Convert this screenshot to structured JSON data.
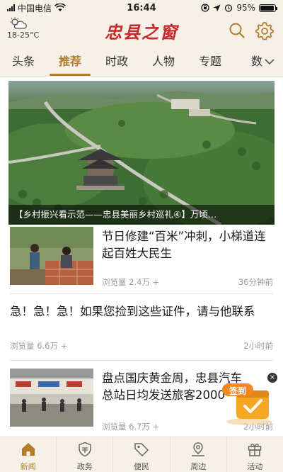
{
  "status_bar": {
    "carrier": "中国电信",
    "time": "16:44",
    "battery_text": "95%",
    "battery_level": 0.95
  },
  "header": {
    "weather_temp": "18-25°C",
    "weather_icon": "sun-cloud-icon",
    "logo_text": "忠县之窗",
    "search_icon": "search-icon",
    "settings_icon": "gear-icon"
  },
  "tabs": [
    {
      "label": "头条",
      "active": false
    },
    {
      "label": "推荐",
      "active": true
    },
    {
      "label": "时政",
      "active": false
    },
    {
      "label": "人物",
      "active": false
    },
    {
      "label": "专题",
      "active": false
    },
    {
      "label": "数",
      "active": false
    }
  ],
  "hero": {
    "caption": "【乡村振兴看示范——忠县美丽乡村巡礼④】万顷…"
  },
  "articles": [
    {
      "title": "节日修建“百米”冲刺，小梯道连起百姓大民生",
      "views": "浏览量 2.4万 +",
      "time": "36分钟前"
    },
    {
      "title": "急！急！急！如果您捡到这些证件，请与他联系",
      "views": "浏览量 6.6万 +",
      "time": "2小时前"
    },
    {
      "title": "盘点国庆黄金周，忠县汽车总站日均发送旅客2000",
      "views": "浏览量 6.7万 +",
      "time": "2小时前"
    }
  ],
  "signin_badge": {
    "label": "签到",
    "close": "×"
  },
  "bottom_nav": [
    {
      "label": "新闻",
      "icon": "home-icon",
      "active": true
    },
    {
      "label": "政务",
      "icon": "shield-icon",
      "active": false
    },
    {
      "label": "便民",
      "icon": "tag-icon",
      "active": false
    },
    {
      "label": "周边",
      "icon": "map-icon",
      "active": false
    },
    {
      "label": "活动",
      "icon": "gift-icon",
      "active": false
    }
  ],
  "colors": {
    "accent": "#b47b2b",
    "logo": "#c7282c",
    "header_bg": "#f6f1e8",
    "badge": "#f5a623"
  }
}
